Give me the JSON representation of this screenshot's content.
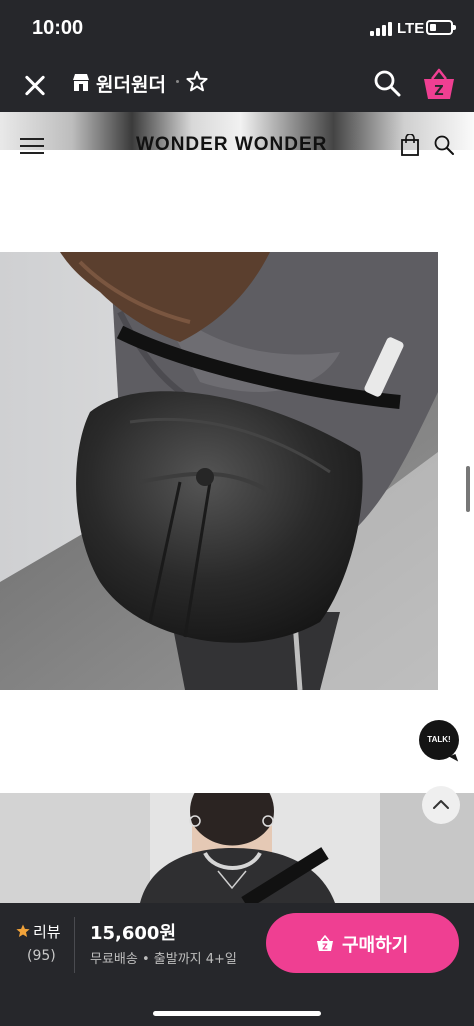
{
  "status_bar": {
    "time": "10:00",
    "network": "LTE",
    "battery_level": 0.3
  },
  "header": {
    "close_icon": "close-icon",
    "store_icon": "store-icon",
    "store_name": "원더원더",
    "favorite_icon": "star-outline-icon",
    "search_icon": "search-icon",
    "cart_icon": "zigzag-cart-icon",
    "cart_badge": "Z"
  },
  "embedded_site": {
    "brand": "WONDER WONDER",
    "menu_icon": "hamburger-icon",
    "bag_icon": "shopping-bag-icon",
    "search_icon": "search-icon"
  },
  "floating": {
    "talk_label": "TALK!",
    "scroll_top_icon": "chevron-up-icon"
  },
  "bottom_bar": {
    "review_label": "리뷰",
    "review_count": "(95)",
    "price": "15,600원",
    "shipping": "무료배송 • 출발까지 4+일",
    "buy_label": "구매하기",
    "accent_color": "#ef3f92"
  }
}
